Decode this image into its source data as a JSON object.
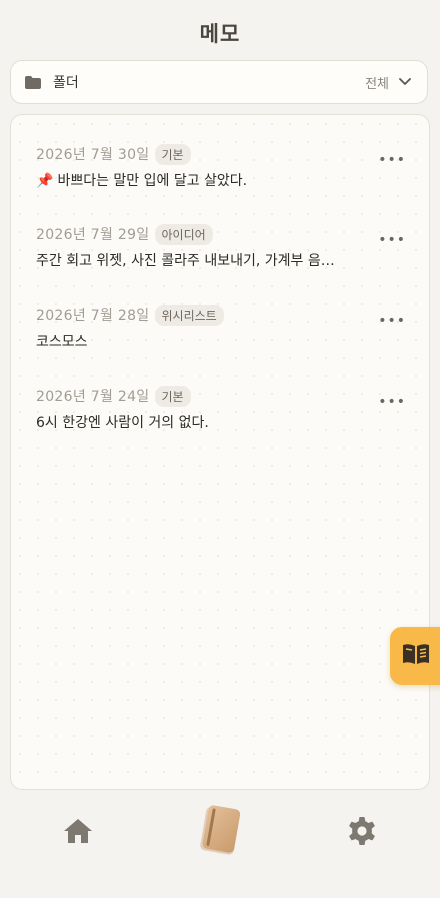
{
  "header": {
    "title": "메모"
  },
  "folder": {
    "label": "폴더",
    "value": "전체"
  },
  "memos": [
    {
      "date": "2026년 7월 30일",
      "tag": "기본",
      "pin": "📌",
      "text": "바쁘다는 말만 입에 달고 살았다."
    },
    {
      "date": "2026년 7월 29일",
      "tag": "아이디어",
      "text": "주간 회고 위젯, 사진 콜라주 내보내기, 가계부 음…"
    },
    {
      "date": "2026년 7월 28일",
      "tag": "위시리스트",
      "text": "코스모스"
    },
    {
      "date": "2026년 7월 24일",
      "tag": "기본",
      "text": "6시 한강엔 사람이 거의 없다."
    }
  ],
  "more_label": "•••",
  "icons": {
    "folder": "folder-icon",
    "chevron": "chevron-down-icon",
    "more": "more-icon",
    "reader": "book-open-icon",
    "home": "home-icon",
    "diary": "notebook-icon",
    "settings": "gear-icon"
  },
  "colors": {
    "accent": "#f9b949",
    "background": "#f4f3ef",
    "panel": "#fcfbf7",
    "tag_bg": "#eeebe5",
    "icon_gray": "#7d7870"
  }
}
